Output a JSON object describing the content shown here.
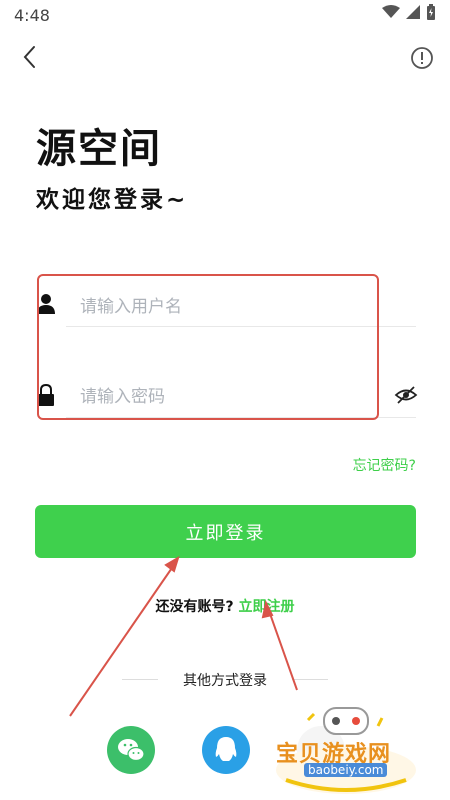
{
  "status_bar": {
    "time": "4:48"
  },
  "header": {
    "back_icon": "chevron-left-icon",
    "info_icon": "info-circle-icon"
  },
  "app_title": "源空间",
  "welcome": "欢迎您登录~",
  "form": {
    "username_placeholder": "请输入用户名",
    "password_placeholder": "请输入密码",
    "username_value": "",
    "password_value": ""
  },
  "forgot_password": "忘记密码?",
  "login_button": "立即登录",
  "register": {
    "prompt": "还没有账号?",
    "link": "立即注册"
  },
  "other_login": {
    "label": "其他方式登录",
    "methods": [
      "wechat-icon",
      "qq-icon"
    ]
  },
  "watermark": {
    "text": "宝贝游戏网",
    "domain": "baobeiy.com"
  },
  "colors": {
    "accent": "#3fd04d",
    "link": "#3ecf4a",
    "annotation": "#d9544a"
  }
}
